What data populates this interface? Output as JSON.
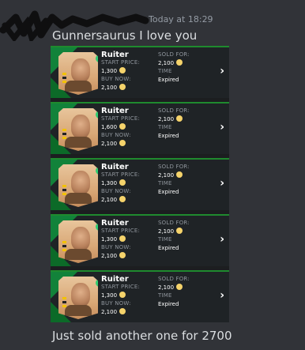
{
  "message": {
    "timestamp": "Today at 18:29",
    "text1": "Gunnersaurus I love you",
    "text2": "Just sold another one for 2700"
  },
  "cards": [
    {
      "name": "Ruiter",
      "start_label": "START PRICE:",
      "start": "1,300",
      "buy_label": "BUY NOW:",
      "buy": "2,100",
      "sold_label": "SOLD FOR:",
      "sold": "2,100",
      "time_label": "TIME",
      "time": "Expired"
    },
    {
      "name": "Ruiter",
      "start_label": "START PRICE:",
      "start": "1,600",
      "buy_label": "BUY NOW:",
      "buy": "2,100",
      "sold_label": "SOLD FOR:",
      "sold": "2,100",
      "time_label": "TIME",
      "time": "Expired"
    },
    {
      "name": "Ruiter",
      "start_label": "START PRICE:",
      "start": "1,300",
      "buy_label": "BUY NOW:",
      "buy": "2,100",
      "sold_label": "SOLD FOR:",
      "sold": "2,100",
      "time_label": "TIME",
      "time": "Expired"
    },
    {
      "name": "Ruiter",
      "start_label": "START PRICE:",
      "start": "1,300",
      "buy_label": "BUY NOW:",
      "buy": "2,100",
      "sold_label": "SOLD FOR:",
      "sold": "2,100",
      "time_label": "TIME",
      "time": "Expired"
    },
    {
      "name": "Ruiter",
      "start_label": "START PRICE:",
      "start": "1,300",
      "buy_label": "BUY NOW:",
      "buy": "2,100",
      "sold_label": "SOLD FOR:",
      "sold": "2,100",
      "time_label": "TIME",
      "time": "Expired"
    }
  ],
  "icons": {
    "coin": "coin-icon",
    "chevron": "chevron-right-icon",
    "verified": "check-badge-icon"
  },
  "colors": {
    "background": "#313338",
    "accent_green": "#1f8a2e",
    "card_bg": "#1f2326",
    "coin": "#f5d36b"
  }
}
